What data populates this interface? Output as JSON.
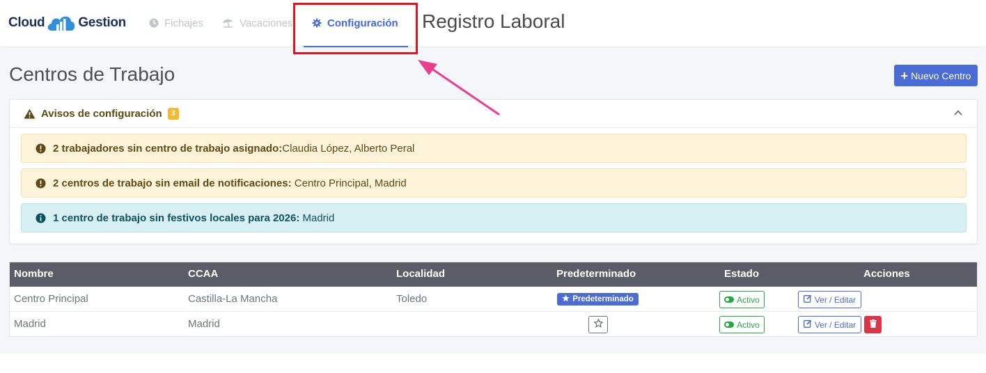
{
  "navbar": {
    "logo": {
      "left": "Cloud",
      "right": "Gestion"
    },
    "items": [
      {
        "label": "Fichajes",
        "icon": "clock-icon",
        "active": false
      },
      {
        "label": "Vacaciones",
        "icon": "beach-umbrella-icon",
        "active": false
      },
      {
        "label": "Configuración",
        "icon": "gear-icon",
        "active": true
      }
    ],
    "app_title": "Registro Laboral"
  },
  "page": {
    "title": "Centros de Trabajo",
    "new_button_label": "Nuevo Centro"
  },
  "warnings": {
    "title": "Avisos de configuración",
    "count": "3",
    "items": [
      {
        "type": "warning",
        "bold": "2 trabajadores sin centro de trabajo asignado:",
        "text": "Claudia López, Alberto Peral"
      },
      {
        "type": "warning",
        "bold": "2 centros de trabajo sin email de notificaciones:",
        "text": " Centro Principal, Madrid"
      },
      {
        "type": "info",
        "bold": "1 centro de trabajo sin festivos locales para 2026:",
        "text": " Madrid"
      }
    ]
  },
  "table": {
    "headers": [
      "Nombre",
      "CCAA",
      "Localidad",
      "Predeterminado",
      "Estado",
      "Acciones"
    ],
    "rows": [
      {
        "nombre": "Centro Principal",
        "ccaa": "Castilla-La Mancha",
        "localidad": "Toledo",
        "predeterminado": "Predeterminado",
        "estado": "Activo",
        "edit_label": "Ver / Editar"
      },
      {
        "nombre": "Madrid",
        "ccaa": "Madrid",
        "localidad": "",
        "predeterminado": "",
        "estado": "Activo",
        "edit_label": "Ver / Editar"
      }
    ]
  },
  "colors": {
    "accent": "#4169e1",
    "primary_button": "#4a6cd4",
    "highlight_box": "#e8121b",
    "annotation_arrow": "#ec3d8e",
    "success": "#28a745",
    "danger": "#dc3545",
    "table_header": "#5a5d67"
  }
}
